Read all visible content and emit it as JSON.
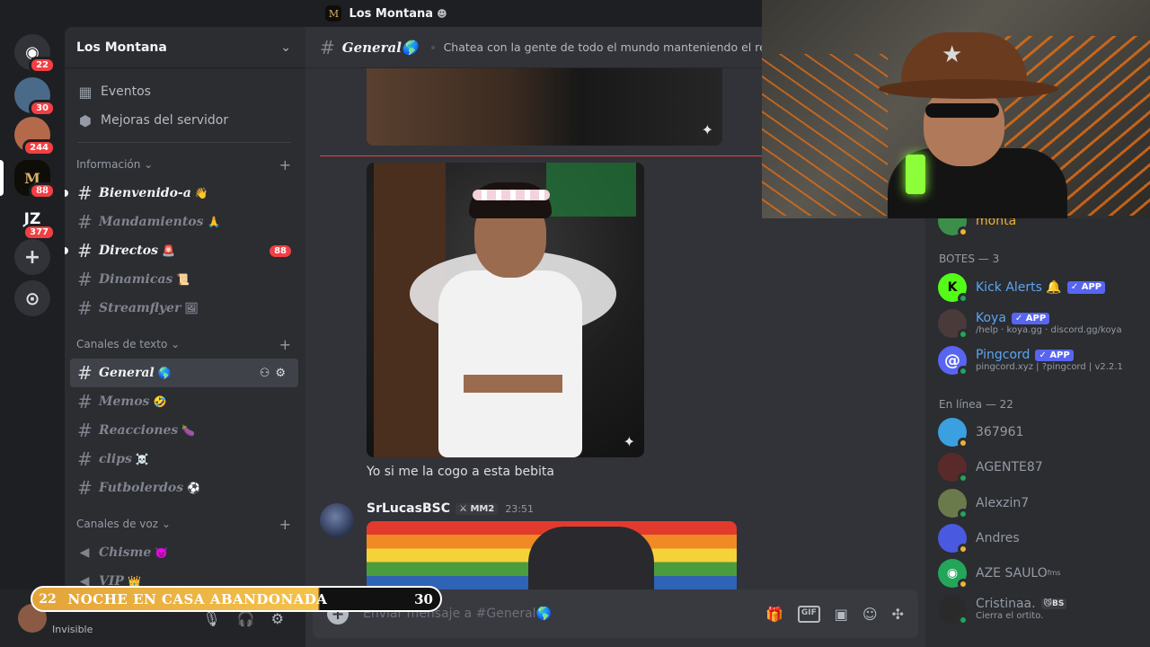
{
  "window": {
    "title": "Los Montana"
  },
  "rail": {
    "home_badge": "22",
    "servers": [
      {
        "label": "",
        "badge": "30",
        "color": "#4a6a8a"
      },
      {
        "label": "",
        "badge": "244",
        "color": "#b46a4a"
      },
      {
        "label": "M",
        "badge": "88",
        "color": "#0f0d08"
      },
      {
        "label": "JZ",
        "badge": "377",
        "color": "#1e1f22"
      }
    ],
    "add_label": "+",
    "explore_label": "⊙"
  },
  "sidebar": {
    "server_name": "Los Montana",
    "events": "Eventos",
    "boosts": "Mejoras del servidor",
    "cat_info": "Información",
    "info_channels": [
      {
        "name": "Bienvenido-a",
        "emoji": "👋"
      },
      {
        "name": "Mandamientos",
        "emoji": "🙏"
      },
      {
        "name": "Directos",
        "emoji": "🚨",
        "badge": "88"
      },
      {
        "name": "Dinamicas",
        "emoji": "📜"
      },
      {
        "name": "Streamflyer",
        "emoji": "🖼"
      }
    ],
    "cat_text": "Canales de texto",
    "text_channels": [
      {
        "name": "General",
        "emoji": "🌎"
      },
      {
        "name": "Memos",
        "emoji": "🤣"
      },
      {
        "name": "Reacciones",
        "emoji": "🍆"
      },
      {
        "name": "clips",
        "emoji": "☠️"
      },
      {
        "name": "Futbolerdos",
        "emoji": "⚽"
      }
    ],
    "cat_voice": "Canales de voz",
    "voice_channels": [
      {
        "name": "Chisme",
        "emoji": "😈"
      },
      {
        "name": "VIP",
        "emoji": "👑"
      }
    ]
  },
  "userpanel": {
    "status": "Invisible"
  },
  "overlay": {
    "left": "22",
    "title": "NOCHE EN CASA ABANDONADA",
    "right": "30"
  },
  "chat": {
    "channel": "General🌎",
    "topic": "Chatea con la gente de todo el mundo manteniendo el respeto.",
    "message_text": "Yo si me la cogo a esta bebita",
    "msg2_user": "SrLucasBSC",
    "msg2_tag": "MM2",
    "msg2_time": "23:51",
    "composer_placeholder": "Enviar mensaje a #General🌎"
  },
  "members": {
    "partial_name": "monta",
    "cat_bots": "BOTES — 3",
    "bots": [
      {
        "name": "Kick Alerts",
        "emoji": "🔔",
        "app": "✓ APP",
        "sub": ""
      },
      {
        "name": "Koya",
        "emoji": "",
        "app": "✓ APP",
        "sub": "/help · koya.gg · discord.gg/koya"
      },
      {
        "name": "Pingcord",
        "emoji": "",
        "app": "✓ APP",
        "sub": "pingcord.xyz | ?pingcord | v2.2.1"
      }
    ],
    "cat_online": "En línea — 22",
    "online": [
      {
        "name": "367961",
        "sub": ""
      },
      {
        "name": "AGENTE87",
        "sub": ""
      },
      {
        "name": "Alexzin7",
        "sub": ""
      },
      {
        "name": "Andres",
        "sub": ""
      },
      {
        "name": "AZE SAULO",
        "sub": ""
      },
      {
        "name": "Cristinaa.",
        "sub": "Cierra el ortito."
      }
    ]
  },
  "colors": {
    "accent": "#5865f2",
    "danger": "#f23f43",
    "online": "#23a55a"
  }
}
